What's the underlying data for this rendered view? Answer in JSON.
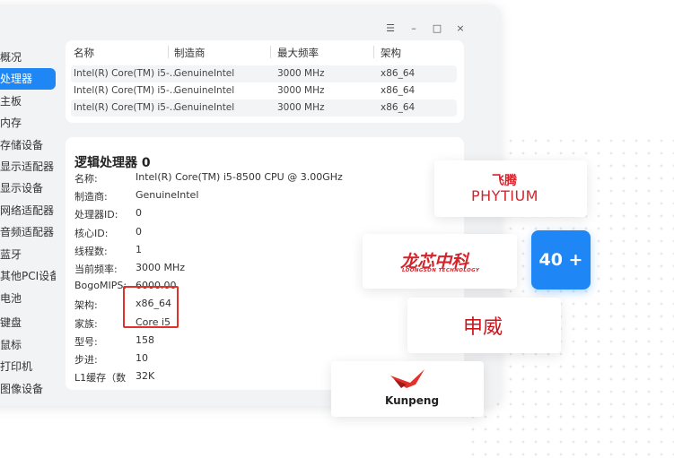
{
  "window": {
    "controls": [
      "☰",
      "–",
      "□",
      "×"
    ]
  },
  "sidebar": {
    "items": [
      {
        "label": "概况"
      },
      {
        "label": "处理器"
      },
      {
        "label": "主板"
      },
      {
        "label": "内存"
      },
      {
        "label": "存储设备"
      },
      {
        "label": "显示适配器"
      },
      {
        "label": "显示设备"
      },
      {
        "label": "网络适配器"
      },
      {
        "label": "音频适配器"
      },
      {
        "label": "蓝牙"
      },
      {
        "label": "其他PCI设备"
      },
      {
        "label": "电池"
      },
      {
        "label": "键盘"
      },
      {
        "label": "鼠标"
      },
      {
        "label": "打印机"
      },
      {
        "label": "图像设备"
      }
    ],
    "active_index": 1
  },
  "cpu_table": {
    "headers": [
      "名称",
      "制造商",
      "最大频率",
      "架构"
    ],
    "rows": [
      [
        "Intel(R) Core(TM) i5-…",
        "GenuineIntel",
        "3000 MHz",
        "x86_64"
      ],
      [
        "Intel(R) Core(TM) i5-…",
        "GenuineIntel",
        "3000 MHz",
        "x86_64"
      ],
      [
        "Intel(R) Core(TM) i5-…",
        "GenuineIntel",
        "3000 MHz",
        "x86_64"
      ]
    ]
  },
  "details": {
    "title": "逻辑处理器 0",
    "fields": [
      {
        "label": "名称:",
        "value": "Intel(R) Core(TM) i5-8500 CPU @ 3.00GHz"
      },
      {
        "label": "制造商:",
        "value": "GenuineIntel"
      },
      {
        "label": "处理器ID:",
        "value": "0"
      },
      {
        "label": "核心ID:",
        "value": "0"
      },
      {
        "label": "线程数:",
        "value": "1"
      },
      {
        "label": "当前频率:",
        "value": "3000 MHz"
      },
      {
        "label": "BogoMIPS:",
        "value": "6000.00"
      },
      {
        "label": "架构:",
        "value": "x86_64"
      },
      {
        "label": "家族:",
        "value": "Core i5"
      },
      {
        "label": "型号:",
        "value": "158"
      },
      {
        "label": "步进:",
        "value": "10"
      },
      {
        "label": "L1缓存（数",
        "value": "32K"
      }
    ]
  },
  "logos": {
    "phytium_cn": "飞腾",
    "phytium_en": "PHYTIUM",
    "loongson_cn": "龙芯中科",
    "loongson_en": "LOONGSON TECHNOLOGY",
    "shenwei": "申威",
    "kunpeng": "Kunpeng",
    "more_badge": "40 +"
  },
  "colors": {
    "accent": "#1e86f5",
    "highlight": "#e0312b",
    "phytium": "#d4242b",
    "loongson": "#d4242b",
    "shenwei": "#c8161d"
  }
}
